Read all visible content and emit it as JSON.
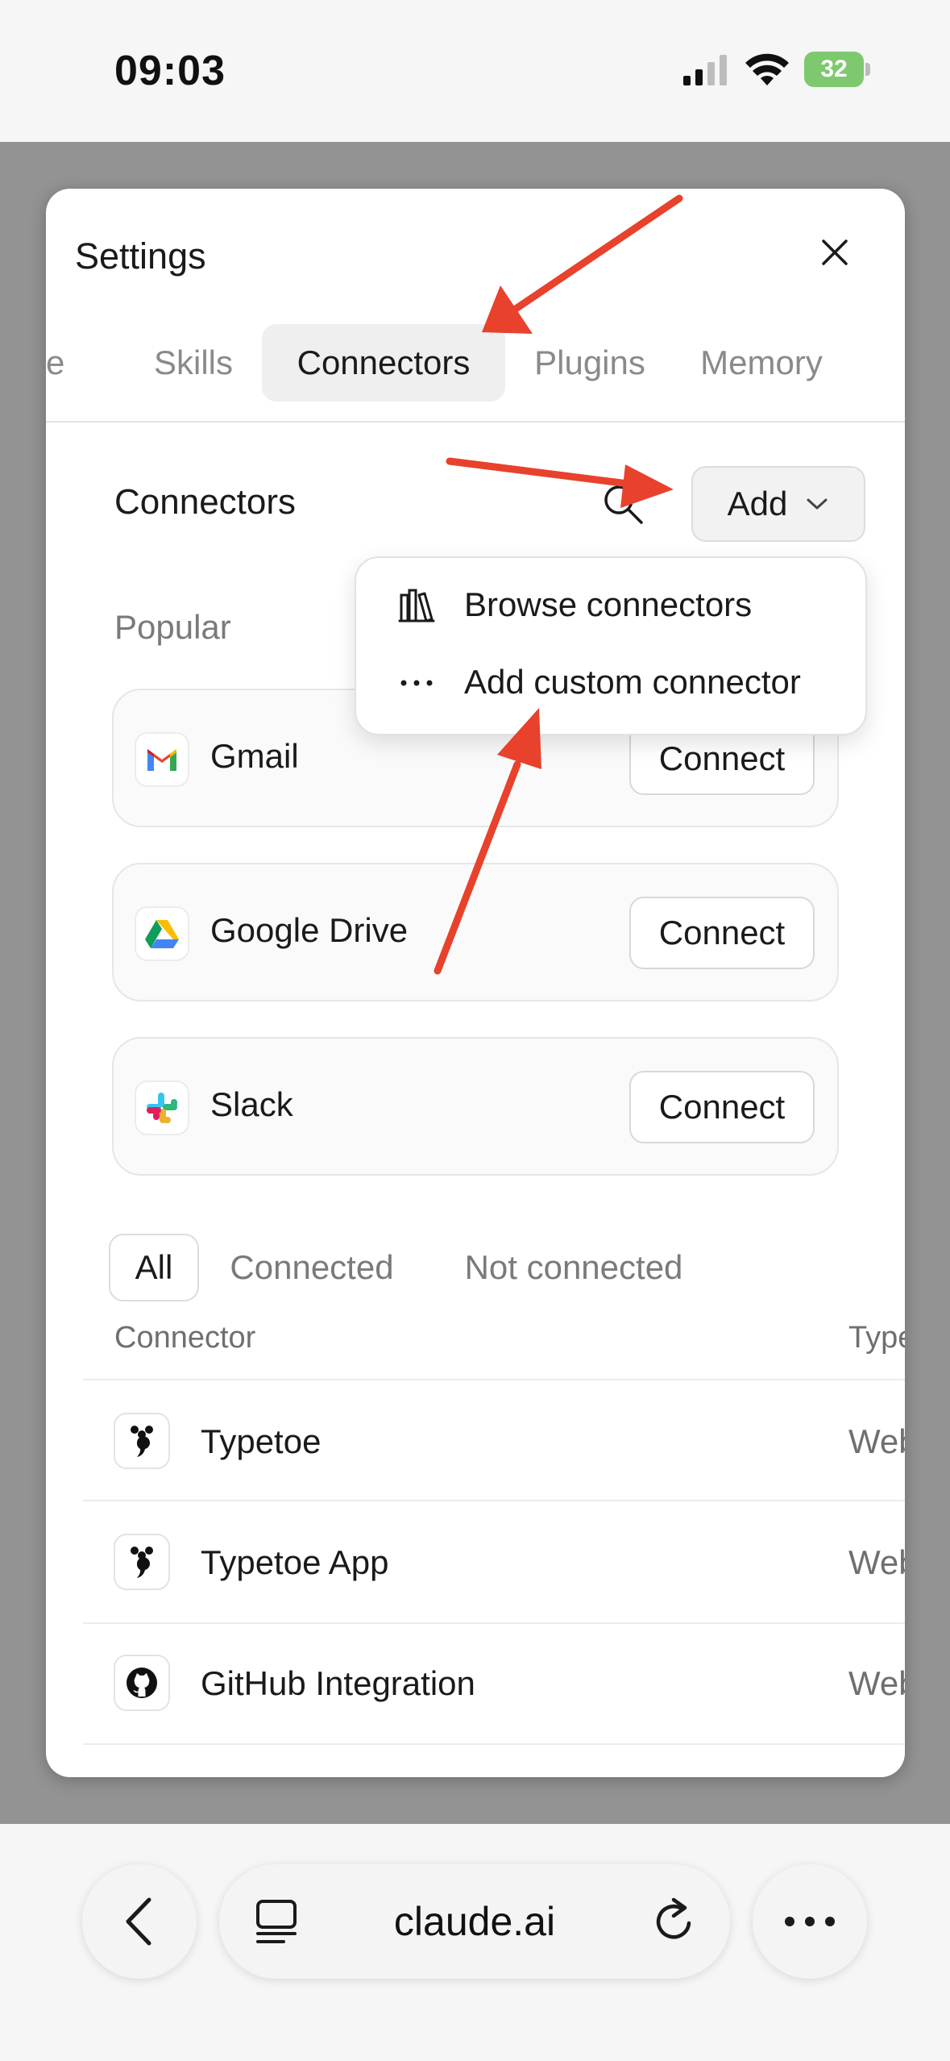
{
  "status_bar": {
    "time": "09:03",
    "battery": "32"
  },
  "modal": {
    "title": "Settings",
    "tabs": [
      {
        "label": "e"
      },
      {
        "label": "Skills"
      },
      {
        "label": "Connectors"
      },
      {
        "label": "Plugins"
      },
      {
        "label": "Memory"
      }
    ],
    "active_tab": "Connectors",
    "section_title": "Connectors",
    "add_button": "Add",
    "dropdown": [
      {
        "label": "Browse connectors",
        "icon": "books-icon"
      },
      {
        "label": "Add custom connector",
        "icon": "more-dots-icon"
      }
    ],
    "popular_label": "Popular",
    "popular": [
      {
        "name": "Gmail",
        "button": "Connect",
        "icon": "gmail-icon"
      },
      {
        "name": "Google Drive",
        "button": "Connect",
        "icon": "google-drive-icon"
      },
      {
        "name": "Slack",
        "button": "Connect",
        "icon": "slack-icon"
      }
    ],
    "filters": [
      {
        "label": "All"
      },
      {
        "label": "Connected"
      },
      {
        "label": "Not connected"
      }
    ],
    "table": {
      "columns": [
        "Connector",
        "Type"
      ],
      "rows": [
        {
          "name": "Typetoe",
          "type": "Web",
          "icon": "typetoe-icon"
        },
        {
          "name": "Typetoe App",
          "type": "Web",
          "icon": "typetoe-icon"
        },
        {
          "name": "GitHub Integration",
          "type": "Web",
          "icon": "github-icon"
        }
      ]
    }
  },
  "browser": {
    "url": "claude.ai"
  },
  "colors": {
    "arrow": "#e8412c",
    "battery": "#7ec96f",
    "backdrop": "#939393"
  }
}
